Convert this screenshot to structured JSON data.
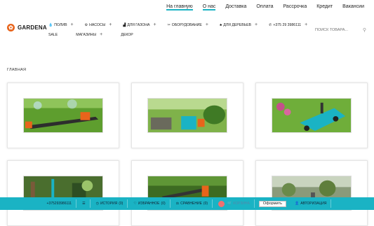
{
  "topbar": {
    "links": [
      "На главную",
      "О нас",
      "Доставка",
      "Оплата",
      "Рассрочка",
      "Кредит",
      "Вакансии"
    ]
  },
  "logo": {
    "text": "GARDENA"
  },
  "nav": {
    "row1": [
      {
        "label": "ПОЛИВ",
        "icon": "drop-icon"
      },
      {
        "label": "НАСОСЫ",
        "icon": "gear-icon"
      },
      {
        "label": "ДЛЯ ГАЗОНА",
        "icon": "mower-icon"
      },
      {
        "label": "ОБОРУДОВАНИЕ",
        "icon": "tools-icon"
      },
      {
        "label": "ДЛЯ ДЕРЕВЬЕВ",
        "icon": "tree-icon"
      },
      {
        "label": "+375 29 3986111",
        "icon": "phone-icon"
      }
    ],
    "row2": [
      {
        "label": "SALE"
      },
      {
        "label": "МАГАЗИНЫ"
      },
      {
        "label": "ДЕКОР"
      }
    ]
  },
  "search": {
    "placeholder": "ПОИСК ТОВАРА..."
  },
  "breadcrumb": "ГЛАВНАЯ",
  "bottombar": {
    "phone": "+375293986111",
    "history": "ИСТОРИЯ",
    "history_count": "(0)",
    "favorites": "ИЗБРАННОЕ",
    "favorites_count": "(0)",
    "compare": "СРАВНЕНИЕ",
    "compare_count": "(0)",
    "cart": "КОРЗИНА",
    "checkout": "Оформить",
    "auth": "АВТОРИЗАЦИЯ"
  },
  "colors": {
    "accent": "#1ab3c4",
    "brand": "#e8641b"
  }
}
